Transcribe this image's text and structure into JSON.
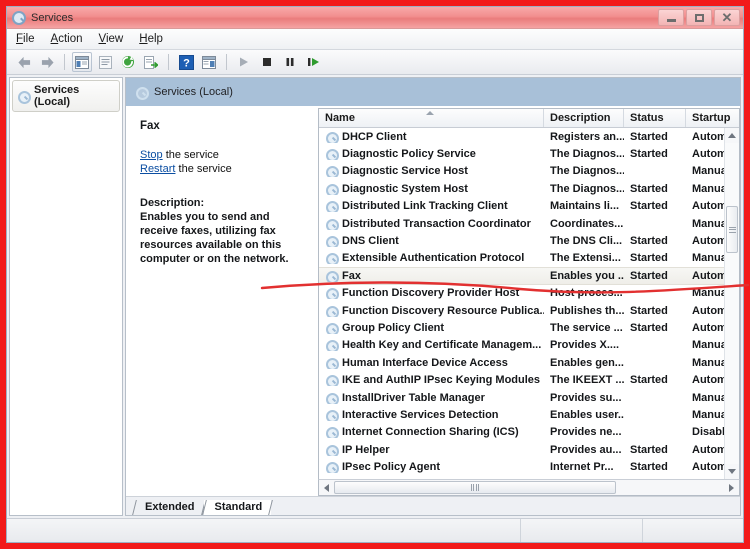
{
  "window": {
    "title": "Services",
    "icon": "services-icon",
    "controls": {
      "minimize": "Minimize",
      "maximize": "Maximize",
      "close": "Close"
    }
  },
  "menu": {
    "items": [
      {
        "label": "File",
        "accel": "F"
      },
      {
        "label": "Action",
        "accel": "A"
      },
      {
        "label": "View",
        "accel": "V"
      },
      {
        "label": "Help",
        "accel": "H"
      }
    ]
  },
  "toolbar": {
    "buttons": [
      {
        "name": "back-button",
        "icon": "arrow-left-icon"
      },
      {
        "name": "forward-button",
        "icon": "arrow-right-icon"
      },
      {
        "name": "show-hide-tree-button",
        "icon": "console-tree-icon"
      },
      {
        "name": "properties-button",
        "icon": "properties-icon"
      },
      {
        "name": "refresh-button",
        "icon": "refresh-icon"
      },
      {
        "name": "export-list-button",
        "icon": "export-list-icon"
      },
      {
        "name": "help-button",
        "icon": "help-icon"
      },
      {
        "name": "show-action-pane-button",
        "icon": "action-pane-icon"
      },
      {
        "name": "start-service-button",
        "icon": "play-icon"
      },
      {
        "name": "stop-service-button",
        "icon": "stop-icon"
      },
      {
        "name": "pause-service-button",
        "icon": "pause-icon"
      },
      {
        "name": "restart-service-button",
        "icon": "restart-icon"
      }
    ]
  },
  "sidebar": {
    "items": [
      {
        "label": "Services (Local)",
        "icon": "services-gear-icon",
        "selected": true
      }
    ]
  },
  "pane": {
    "header_title": "Services (Local)",
    "header_icon": "services-gear-icon"
  },
  "detail": {
    "service_name": "Fax",
    "actions": [
      {
        "link": "Stop",
        "suffix": " the service"
      },
      {
        "link": "Restart",
        "suffix": " the service"
      }
    ],
    "description_label": "Description:",
    "description_text": "Enables you to send and receive faxes, utilizing fax resources available on this computer or on the network."
  },
  "list": {
    "columns": [
      {
        "key": "name",
        "label": "Name",
        "sorted": "asc"
      },
      {
        "key": "description",
        "label": "Description"
      },
      {
        "key": "status",
        "label": "Status"
      },
      {
        "key": "startup",
        "label": "Startup"
      }
    ],
    "rows": [
      {
        "name": "DHCP Client",
        "description": "Registers an...",
        "status": "Started",
        "startup": "Automa",
        "selected": false
      },
      {
        "name": "Diagnostic Policy Service",
        "description": "The Diagnos...",
        "status": "Started",
        "startup": "Automa",
        "selected": false
      },
      {
        "name": "Diagnostic Service Host",
        "description": "The Diagnos...",
        "status": "",
        "startup": "Manual",
        "selected": false
      },
      {
        "name": "Diagnostic System Host",
        "description": "The Diagnos...",
        "status": "Started",
        "startup": "Manual",
        "selected": false
      },
      {
        "name": "Distributed Link Tracking Client",
        "description": "Maintains li...",
        "status": "Started",
        "startup": "Automa",
        "selected": false
      },
      {
        "name": "Distributed Transaction Coordinator",
        "description": "Coordinates...",
        "status": "",
        "startup": "Manual",
        "selected": false
      },
      {
        "name": "DNS Client",
        "description": "The DNS Cli...",
        "status": "Started",
        "startup": "Automa",
        "selected": false
      },
      {
        "name": "Extensible Authentication Protocol",
        "description": "The Extensi...",
        "status": "Started",
        "startup": "Manual",
        "selected": false
      },
      {
        "name": "Fax",
        "description": "Enables you ...",
        "status": "Started",
        "startup": "Automa",
        "selected": true
      },
      {
        "name": "Function Discovery Provider Host",
        "description": "Host proces...",
        "status": "",
        "startup": "Manual",
        "selected": false
      },
      {
        "name": "Function Discovery Resource Publica...",
        "description": "Publishes th...",
        "status": "Started",
        "startup": "Automa",
        "selected": false
      },
      {
        "name": "Group Policy Client",
        "description": "The service ...",
        "status": "Started",
        "startup": "Automa",
        "selected": false
      },
      {
        "name": "Health Key and Certificate Managem...",
        "description": "Provides X....",
        "status": "",
        "startup": "Manual",
        "selected": false
      },
      {
        "name": "Human Interface Device Access",
        "description": "Enables gen...",
        "status": "",
        "startup": "Manual",
        "selected": false
      },
      {
        "name": "IKE and AuthIP IPsec Keying Modules",
        "description": "The IKEEXT ...",
        "status": "Started",
        "startup": "Automa",
        "selected": false
      },
      {
        "name": "InstallDriver Table Manager",
        "description": "Provides su...",
        "status": "",
        "startup": "Manual",
        "selected": false
      },
      {
        "name": "Interactive Services Detection",
        "description": "Enables user...",
        "status": "",
        "startup": "Manual",
        "selected": false
      },
      {
        "name": "Internet Connection Sharing (ICS)",
        "description": "Provides ne...",
        "status": "",
        "startup": "Disabled",
        "selected": false
      },
      {
        "name": "IP Helper",
        "description": "Provides au...",
        "status": "Started",
        "startup": "Automa",
        "selected": false
      },
      {
        "name": "IPsec Policy Agent",
        "description": "Internet Pr...",
        "status": "Started",
        "startup": "Automa",
        "selected": false
      }
    ]
  },
  "tabs": [
    {
      "label": "Extended",
      "active": false
    },
    {
      "label": "Standard",
      "active": true
    }
  ],
  "status_bar": {
    "text": ""
  },
  "annotation": {
    "color": "#f21a1a",
    "border_color": "#f21a1a",
    "underline_shape": "wavy-line-under-fax-row"
  },
  "colors": {
    "titlebar": "#f08c8c",
    "pane_header": "#a8c0d8",
    "link": "#0b4ea2",
    "annotation_red": "#f21a1a"
  }
}
